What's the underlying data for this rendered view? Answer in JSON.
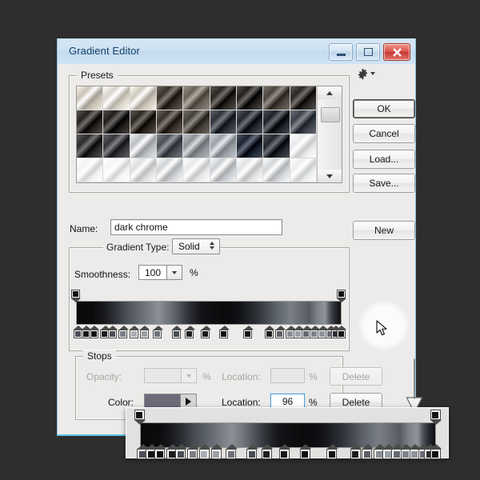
{
  "window": {
    "title": "Gradient Editor",
    "controls": {
      "minimize": "minimize-button",
      "maximize": "maximize-button",
      "close": "close-button"
    }
  },
  "presets": {
    "label": "Presets",
    "gear_icon": "gear-icon",
    "menu_caret": "caret-down-icon",
    "scrollbar": {
      "up": "scroll-up-arrow",
      "down": "scroll-down-arrow",
      "thumb_top_pct": 21
    },
    "swatch_colors": [
      [
        "#c8c2b6",
        "#d8d3c8",
        "#cfc9bd",
        "#3a322a",
        "#6a6258",
        "#2a2622",
        "#23201d",
        "#4a443c",
        "#2b2724"
      ],
      [
        "#272421",
        "#201d1a",
        "#2c2720",
        "#39322a",
        "#45403a",
        "#2e3238",
        "#24282e",
        "#1e2228",
        "#3c4048"
      ],
      [
        "#2a2a2c",
        "#34363a",
        "#b9bcc0",
        "#4a4e55",
        "#8d9196",
        "#9aa0a6",
        "#1b2430",
        "#23262c",
        "#e8eaec"
      ],
      [
        "#f2f3f4",
        "#f6f6f6",
        "#dcdee0",
        "#cfd2d5",
        "#e6e8ea",
        "#c9ccd0",
        "#dfe1e3",
        "#d2d5d8",
        "#eceeef"
      ]
    ]
  },
  "buttons": {
    "ok": "OK",
    "cancel": "Cancel",
    "load": "Load...",
    "save": "Save...",
    "new": "New"
  },
  "name_field": {
    "label": "Name:",
    "value": "dark chrome"
  },
  "gradient_type": {
    "label": "Gradient Type:",
    "value": "Solid",
    "spinner_icon": "spinner-updown-icon"
  },
  "smoothness": {
    "label": "Smoothness:",
    "value": "100",
    "unit": "%",
    "dropdown_icon": "caret-down-icon"
  },
  "gradient_bar": {
    "css": "linear-gradient(to right,#0a0a0c 0%,#0b0b0d 6%,#17181b 10%,#2b2e33 14%,#454a51 18%,#5b6068 22%,#6b7077 25%,#7b8087 28%,#8b9097 31%,#6e737a 35%,#4c5157 39%,#2a2d32 43%,#131417 47%,#0d0e10 52%,#0a0b0d 57%,#101114 61%,#1b1d21 64%,#2d3036 68%,#454951 72%,#5a5f67 75%,#6a6f77 78%,#7a7f86 81%,#666b72 85%,#565b62 88%,#7c8188 91%,#8f949b 94%,#4a4f56 96%,#23262b 98%,#0e0f12 100%)",
    "opacity_stops": [
      {
        "pos_pct": 0,
        "opacity": 100
      },
      {
        "pos_pct": 100,
        "opacity": 100
      }
    ],
    "color_stops": [
      {
        "pos_pct": 1,
        "color": "#4b5058"
      },
      {
        "pos_pct": 4,
        "color": "#111214"
      },
      {
        "pos_pct": 7,
        "color": "#0d0e10"
      },
      {
        "pos_pct": 11,
        "color": "#1a1c20"
      },
      {
        "pos_pct": 14,
        "color": "#4a4f57"
      },
      {
        "pos_pct": 18,
        "color": "#7a7f86"
      },
      {
        "pos_pct": 22,
        "color": "#a9aeb4"
      },
      {
        "pos_pct": 26,
        "color": "#9aa0a6"
      },
      {
        "pos_pct": 31,
        "color": "#6e737a"
      },
      {
        "pos_pct": 38,
        "color": "#474c54"
      },
      {
        "pos_pct": 43,
        "color": "#1b1d21"
      },
      {
        "pos_pct": 49,
        "color": "#17181b"
      },
      {
        "pos_pct": 56,
        "color": "#0e0f12"
      },
      {
        "pos_pct": 65,
        "color": "#121316"
      },
      {
        "pos_pct": 73,
        "color": "#191b1f"
      },
      {
        "pos_pct": 77,
        "color": "#5b6068"
      },
      {
        "pos_pct": 81,
        "color": "#8a8f96"
      },
      {
        "pos_pct": 84,
        "color": "#9aa0a6"
      },
      {
        "pos_pct": 87,
        "color": "#656a71"
      },
      {
        "pos_pct": 90,
        "color": "#7f848b"
      },
      {
        "pos_pct": 93,
        "color": "#8f949b"
      },
      {
        "pos_pct": 96,
        "color": "#6b6b7a"
      },
      {
        "pos_pct": 98,
        "color": "#2a2d32"
      },
      {
        "pos_pct": 100,
        "color": "#0f1013"
      }
    ]
  },
  "stops": {
    "label": "Stops",
    "opacity_label": "Opacity:",
    "opacity_value": "",
    "opacity_unit": "%",
    "opacity_location_label": "Location:",
    "opacity_location_value": "",
    "opacity_location_unit": "%",
    "opacity_delete": "Delete",
    "color_label": "Color:",
    "color_value": "#6b6b7a",
    "color_caret_icon": "caret-right-icon",
    "color_location_label": "Location:",
    "color_location_value": "96",
    "color_location_unit": "%",
    "color_delete": "Delete"
  },
  "annotations": {
    "magnifier": "magnifier-highlight",
    "cursor": "mouse-cursor",
    "arrow": "down-arrow-annotation"
  },
  "inset": {
    "name": "zoomed-gradient-bar-inset",
    "opacity_stops": [
      {
        "pos_pct": 0
      },
      {
        "pos_pct": 100
      }
    ],
    "color_stops": [
      {
        "pos_pct": 1,
        "color": "#4b5058"
      },
      {
        "pos_pct": 4,
        "color": "#111214"
      },
      {
        "pos_pct": 7,
        "color": "#0d0e10"
      },
      {
        "pos_pct": 11,
        "color": "#1a1c20"
      },
      {
        "pos_pct": 14,
        "color": "#4a4f57"
      },
      {
        "pos_pct": 18,
        "color": "#7a7f86"
      },
      {
        "pos_pct": 22,
        "color": "#a9aeb4"
      },
      {
        "pos_pct": 26,
        "color": "#9aa0a6"
      },
      {
        "pos_pct": 31,
        "color": "#6e737a"
      },
      {
        "pos_pct": 38,
        "color": "#474c54"
      },
      {
        "pos_pct": 43,
        "color": "#1b1d21"
      },
      {
        "pos_pct": 49,
        "color": "#17181b"
      },
      {
        "pos_pct": 56,
        "color": "#0e0f12"
      },
      {
        "pos_pct": 65,
        "color": "#121316"
      },
      {
        "pos_pct": 73,
        "color": "#191b1f"
      },
      {
        "pos_pct": 77,
        "color": "#5b6068"
      },
      {
        "pos_pct": 81,
        "color": "#8a8f96"
      },
      {
        "pos_pct": 84,
        "color": "#9aa0a6"
      },
      {
        "pos_pct": 87,
        "color": "#656a71"
      },
      {
        "pos_pct": 90,
        "color": "#7f848b"
      },
      {
        "pos_pct": 93,
        "color": "#8f949b"
      },
      {
        "pos_pct": 96,
        "color": "#6b6b7a"
      },
      {
        "pos_pct": 98,
        "color": "#2a2d32"
      },
      {
        "pos_pct": 100,
        "color": "#0f1013"
      }
    ]
  }
}
